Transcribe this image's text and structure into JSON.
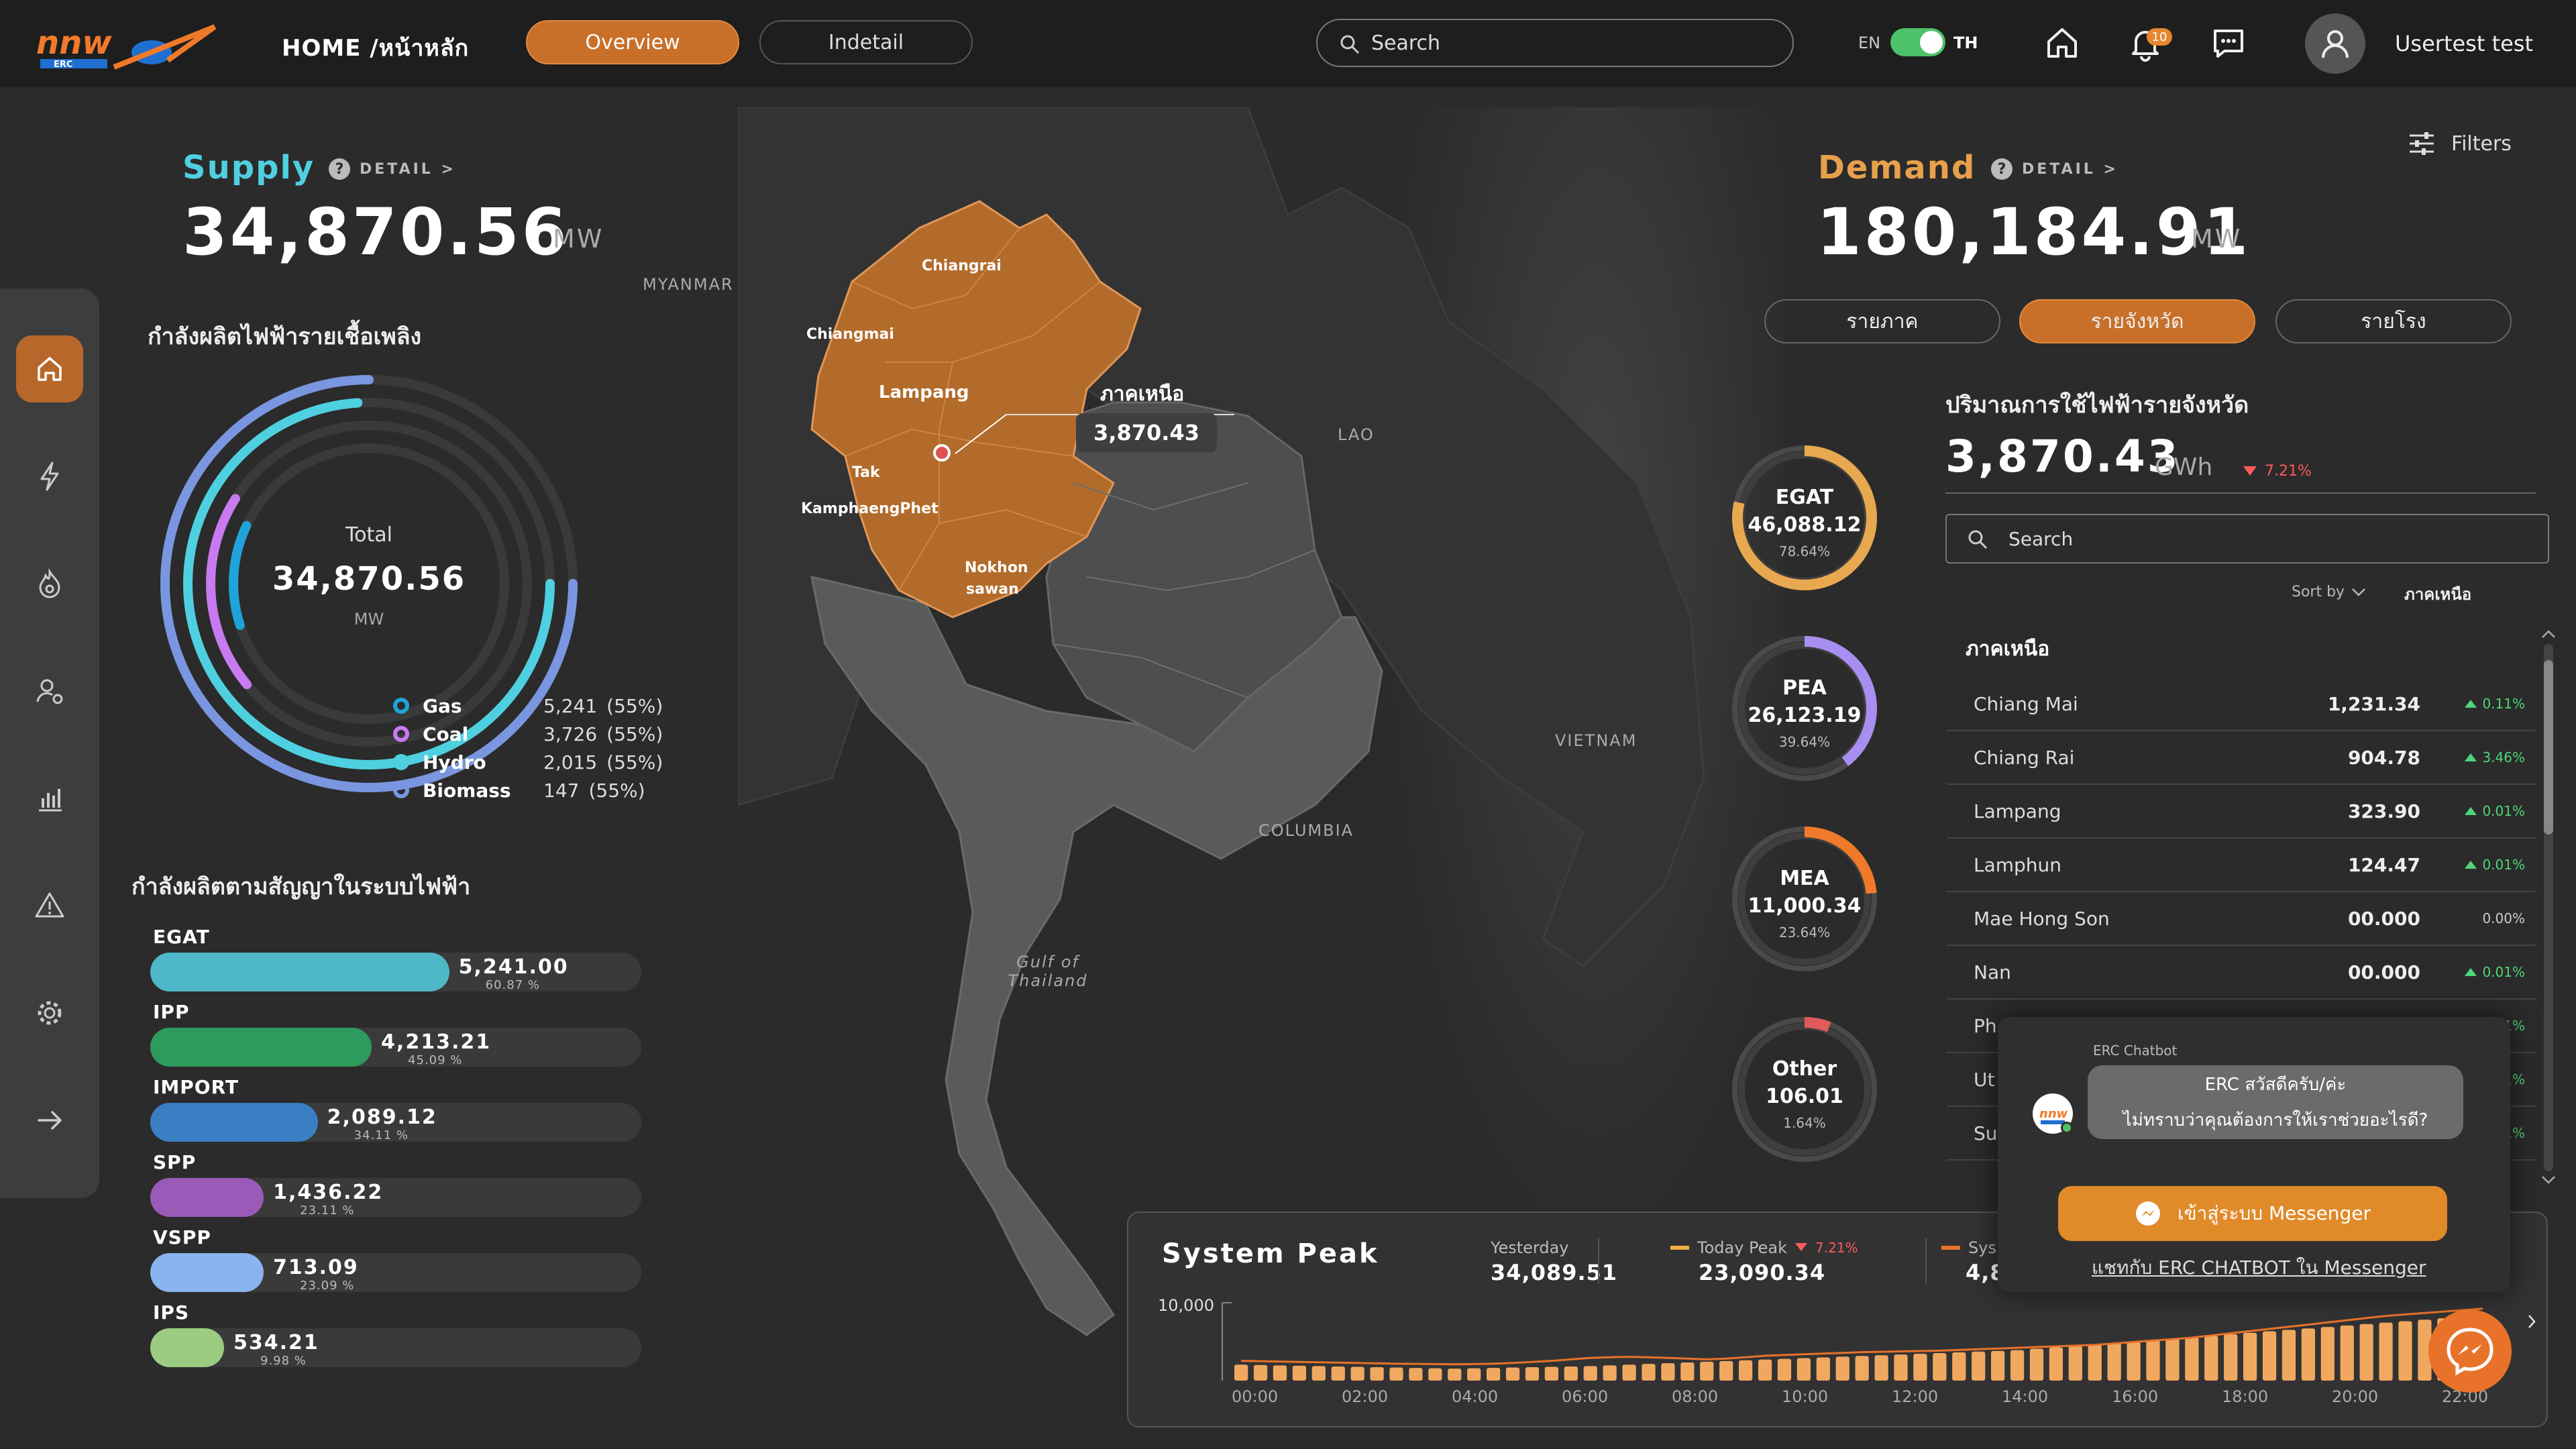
{
  "header": {
    "breadcrumb": "HOME /หน้าหลัก",
    "tabs": [
      "Overview",
      "Indetail"
    ],
    "search_placeholder": "Search",
    "lang_left": "EN",
    "lang_right": "TH",
    "notification_count": "10",
    "username": "Usertest test"
  },
  "supply": {
    "title": "Supply",
    "detail": "DETAIL >",
    "value": "34,870.56",
    "unit": "MW",
    "fuel_heading": "กำลังผลิตไฟฟ้ารายเชื้อเพลิง",
    "total_label": "Total",
    "total_value": "34,870.56",
    "total_unit": "MW",
    "fuels": [
      {
        "name": "Gas",
        "value": "5,241",
        "pct": "(55%)",
        "color": "#1fa3d8"
      },
      {
        "name": "Coal",
        "value": "3,726",
        "pct": "(55%)",
        "color": "#c87af0"
      },
      {
        "name": "Hydro",
        "value": "2,015",
        "pct": "(55%)",
        "color": "#4fd0e0"
      },
      {
        "name": "Biomass",
        "value": "147",
        "pct": "(55%)",
        "color": "#7a96e0"
      }
    ],
    "contract_heading": "กำลังผลิตตามสัญญาในระบบไฟฟ้า",
    "contracts": [
      {
        "name": "EGAT",
        "value": "5,241.00",
        "pct": "60.87 %",
        "fill": 0.6087,
        "color": "#4fb8c8"
      },
      {
        "name": "IPP",
        "value": "4,213.21",
        "pct": "45.09 %",
        "fill": 0.4509,
        "color": "#2f9a5e"
      },
      {
        "name": "IMPORT",
        "value": "2,089.12",
        "pct": "34.11 %",
        "fill": 0.3411,
        "color": "#3a7ec4"
      },
      {
        "name": "SPP",
        "value": "1,436.22",
        "pct": "23.11 %",
        "fill": 0.2311,
        "color": "#9a5ab8"
      },
      {
        "name": "VSPP",
        "value": "713.09",
        "pct": "23.09 %",
        "fill": 0.2309,
        "color": "#8ab4ee"
      },
      {
        "name": "IPS",
        "value": "534.21",
        "pct": "9.98 %",
        "fill": 0.0998,
        "color": "#9ccc82"
      }
    ]
  },
  "map": {
    "labels": [
      "MYANMAR",
      "LAO",
      "VIETNAM",
      "COLUMBIA"
    ],
    "gulf_line1": "Gulf of",
    "gulf_line2": "Thailand",
    "provinces": [
      "Chiangrai",
      "Chiangmai",
      "Lampang",
      "Tak",
      "KamphaengPhet",
      "Nokhon",
      "sawan"
    ],
    "tooltip_title": "ภาคเหนือ",
    "tooltip_value": "3,870.43"
  },
  "demand": {
    "title": "Demand",
    "detail": "DETAIL >",
    "value": "180,184.91",
    "unit": "MW",
    "filters": "Filters",
    "segments": [
      "รายภาค",
      "รายจังหวัด",
      "รายโรง"
    ],
    "usage_heading": "ปริมาณการใช้ไฟฟ้ารายจังหวัด",
    "usage_value": "3,870.43",
    "usage_unit": "GWh",
    "usage_change": "7.21%",
    "search_placeholder": "Search",
    "sort_label": "Sort by",
    "sort_value": "ภาคเหนือ",
    "region_heading": "ภาคเหนือ",
    "rings": [
      {
        "name": "EGAT",
        "value": "46,088.12",
        "pct": "78.64%",
        "fraction": 0.7864,
        "color": "#e8a850"
      },
      {
        "name": "PEA",
        "value": "26,123.19",
        "pct": "39.64%",
        "fraction": 0.3964,
        "color": "#a88ef0"
      },
      {
        "name": "MEA",
        "value": "11,000.34",
        "pct": "23.64%",
        "fraction": 0.2364,
        "color": "#f07a2a"
      },
      {
        "name": "Other",
        "value": "106.01",
        "pct": "1.64%",
        "fraction": 0.0164,
        "color": "#e05a5a"
      }
    ],
    "provinces": [
      {
        "name": "Chiang Mai",
        "value": "1,231.34",
        "change": "0.11%",
        "dir": "up"
      },
      {
        "name": "Chiang Rai",
        "value": "904.78",
        "change": "3.46%",
        "dir": "up"
      },
      {
        "name": "Lampang",
        "value": "323.90",
        "change": "0.01%",
        "dir": "up"
      },
      {
        "name": "Lamphun",
        "value": "124.47",
        "change": "0.01%",
        "dir": "up"
      },
      {
        "name": "Mae Hong Son",
        "value": "00.000",
        "change": "0.00%",
        "dir": "flat"
      },
      {
        "name": "Nan",
        "value": "00.000",
        "change": "0.01%",
        "dir": "up"
      },
      {
        "name": "Ph",
        "value": "",
        "change": "0.01%",
        "dir": "up"
      },
      {
        "name": "Ut",
        "value": "",
        "change": "1%",
        "dir": "up"
      },
      {
        "name": "Su",
        "value": "",
        "change": "1%",
        "dir": "up"
      }
    ]
  },
  "system_peak": {
    "title": "System Peak",
    "yesterday_label": "Yesterday",
    "yesterday_value": "34,089.51",
    "today_label": "Today Peak",
    "today_change": "7.21%",
    "today_value": "23,090.34",
    "sys_label": "Sys",
    "sys_value": "4,8",
    "colors": {
      "bars": "#f0a860",
      "line": "#e8722a"
    }
  },
  "chart_data": {
    "type": "bar",
    "title": "System Peak",
    "x_ticks": [
      "00:00",
      "02:00",
      "04:00",
      "06:00",
      "08:00",
      "10:00",
      "12:00",
      "14:00",
      "16:00",
      "18:00",
      "20:00",
      "22:00"
    ],
    "y_ticks": [
      "10,000"
    ],
    "ylim": [
      0,
      10000
    ],
    "values": [
      2200,
      2150,
      2100,
      2050,
      2000,
      1950,
      1900,
      1850,
      1800,
      1750,
      1700,
      1650,
      1700,
      1750,
      1800,
      1850,
      1900,
      1950,
      2000,
      2100,
      2200,
      2300,
      2400,
      2500,
      2600,
      2700,
      2800,
      2900,
      3000,
      3100,
      3200,
      3300,
      3400,
      3500,
      3600,
      3700,
      3800,
      3900,
      4000,
      4100,
      4200,
      4400,
      4600,
      4800,
      5000,
      5200,
      5400,
      5600,
      5800,
      6000,
      6200,
      6400,
      6600,
      6800,
      7000,
      7200,
      7400,
      7600,
      7800,
      8000,
      8200,
      8400,
      8600,
      8800,
      9000
    ],
    "line": [
      1800,
      1750,
      1700,
      1650,
      1600,
      1550,
      1500,
      1450,
      1400,
      1380,
      1350,
      1320,
      1350,
      1400,
      1500,
      1650,
      1800,
      2000,
      2200,
      2300,
      2350,
      2300,
      2200,
      2100,
      2000,
      2100,
      2300,
      2500,
      2600,
      2700,
      2800,
      2900,
      3000,
      3050,
      3100,
      3150,
      3200,
      3300,
      3400,
      3500,
      3600,
      3700,
      3800,
      3900,
      4000,
      4200,
      4400,
      4600,
      4800,
      5000,
      5300,
      5600,
      5900,
      6200,
      6500,
      6800,
      7100,
      7400,
      7700,
      8000,
      8200,
      8400,
      8600,
      8800,
      9000
    ]
  },
  "chatbot": {
    "name": "ERC Chatbot",
    "message_line1": "ERC สวัสดีครับ/ค่ะ",
    "message_line2": "ไม่ทราบว่าคุณต้องการให้เราช่วยอะไรดี?",
    "button": "เข้าสู่ระบบ Messenger",
    "link": "แชทกับ ERC CHATBOT ใน Messenger"
  }
}
